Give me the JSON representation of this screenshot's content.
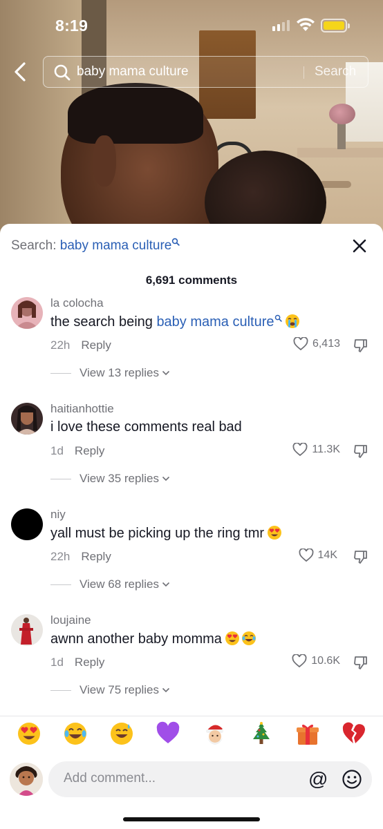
{
  "status_bar": {
    "time": "8:19"
  },
  "search": {
    "query": "baby mama culture",
    "button_label": "Search"
  },
  "sheet": {
    "title_prefix": "Search: ",
    "title_query": "baby mama culture",
    "comment_count": "6,691 comments"
  },
  "comments": [
    {
      "username": "la colocha",
      "text_prefix": "the search being ",
      "text_link": "baby mama culture",
      "text": "",
      "emojis": [
        "loudly-crying-face"
      ],
      "age": "22h",
      "reply_label": "Reply",
      "likes": "6,413",
      "replies": "View 13 replies"
    },
    {
      "username": "haitianhottie",
      "text": "i love these comments real bad",
      "emojis": [],
      "age": "1d",
      "reply_label": "Reply",
      "likes": "11.3K",
      "replies": "View 35 replies"
    },
    {
      "username": "niy",
      "text": "yall must be picking up the ring tmr",
      "emojis": [
        "heart-eyes"
      ],
      "age": "22h",
      "reply_label": "Reply",
      "likes": "14K",
      "replies": "View 68 replies"
    },
    {
      "username": "loujaine",
      "text": "awnn another baby momma",
      "emojis": [
        "heart-eyes",
        "joy"
      ],
      "age": "1d",
      "reply_label": "Reply",
      "likes": "10.6K",
      "replies": "View 75 replies"
    }
  ],
  "emoji_bar": [
    "heart-eyes",
    "joy",
    "sweat-smile",
    "purple-heart",
    "santa",
    "christmas-tree",
    "gift",
    "broken-heart"
  ],
  "composer": {
    "placeholder": "Add comment...",
    "mention_label": "@"
  },
  "colors": {
    "link": "#2a5fb5",
    "battery": "#f5d51a"
  }
}
